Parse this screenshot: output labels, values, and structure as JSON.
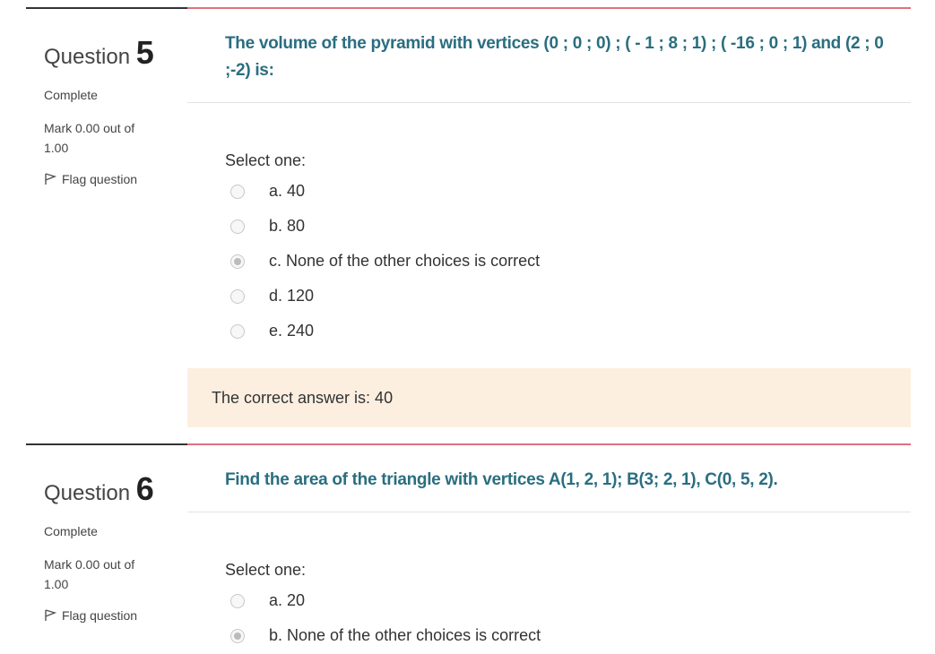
{
  "questions": [
    {
      "label": "Question",
      "number": "5",
      "state": "Complete",
      "grade": "Mark 0.00 out of 1.00",
      "flag_label": "Flag question",
      "text": "The volume of the pyramid with vertices (0 ; 0 ; 0) ; ( - 1 ; 8 ; 1) ; ( -16 ; 0 ; 1) and (2 ; 0 ;-2) is:",
      "select_label": "Select one:",
      "options": [
        {
          "label": "a. 40",
          "selected": false
        },
        {
          "label": "b. 80",
          "selected": false
        },
        {
          "label": "c. None of the other choices is correct",
          "selected": true
        },
        {
          "label": "d. 120",
          "selected": false
        },
        {
          "label": "e. 240",
          "selected": false
        }
      ],
      "feedback": "The correct answer is: 40"
    },
    {
      "label": "Question",
      "number": "6",
      "state": "Complete",
      "grade": "Mark 0.00 out of 1.00",
      "flag_label": "Flag question",
      "text": "Find the area of the triangle with vertices A(1, 2, 1); B(3; 2, 1), C(0, 5, 2).",
      "select_label": "Select one:",
      "options": [
        {
          "label": "a. 20",
          "selected": false
        },
        {
          "label": "b. None of the other choices is correct",
          "selected": true
        }
      ]
    }
  ],
  "colors": {
    "question_text": "#2a6e80",
    "content_border": "#e07080",
    "feedback_bg": "#fcefe0"
  }
}
